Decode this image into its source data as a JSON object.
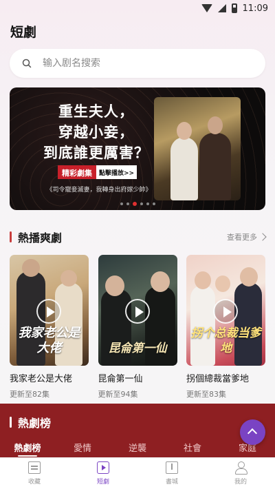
{
  "status_bar": {
    "time": "11:09"
  },
  "header": {
    "title": "短劇"
  },
  "search": {
    "placeholder": "输入剧名搜索"
  },
  "banner": {
    "headline_lines": [
      "重生夫人，",
      "穿越小妾，",
      "到底誰更厲害？"
    ],
    "tag": "精彩劇集",
    "cta": "點擊播放>>",
    "caption": "《司令寵妾滅妻，我轉身出府嫁少帥》",
    "slide_count": 6,
    "active_slide": 3
  },
  "hot_section": {
    "title": "熱播爽劇",
    "see_more": "查看更多"
  },
  "cards": [
    {
      "title": "我家老公是大佬",
      "subtitle": "更新至82集",
      "art_text": "我家老公是大佬"
    },
    {
      "title": "昆侖第一仙",
      "subtitle": "更新至94集",
      "art_text": "昆侖第一仙"
    },
    {
      "title": "拐個總裁當爹地",
      "subtitle": "更新至83集",
      "art_text": "拐个总裁当爹地"
    }
  ],
  "rank": {
    "title": "熱劇榜",
    "tabs": [
      "熱劇榜",
      "愛情",
      "逆襲",
      "社會",
      "家庭"
    ],
    "active_tab": 0
  },
  "bottom_nav": [
    {
      "label": "收藏",
      "icon": "collection-icon"
    },
    {
      "label": "短劇",
      "icon": "video-icon",
      "active": true
    },
    {
      "label": "書城",
      "icon": "store-icon"
    },
    {
      "label": "我的",
      "icon": "user-icon"
    }
  ],
  "colors": {
    "accent": "#7a43c3",
    "rank_bg": "#8e1f22",
    "section_bar": "#c83c3c"
  }
}
